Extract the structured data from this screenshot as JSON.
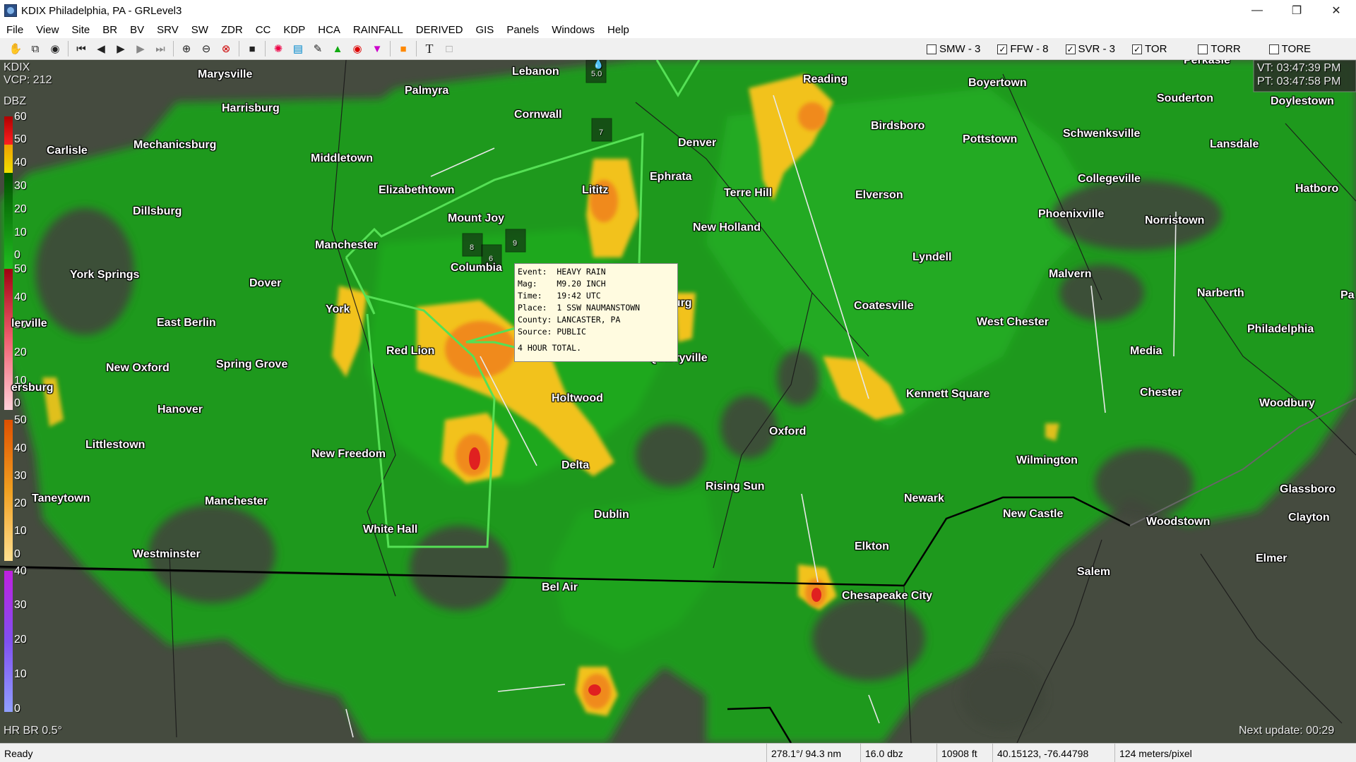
{
  "window": {
    "title": "KDIX Philadelphia, PA - GRLevel3",
    "minimize": "—",
    "maximize": "❐",
    "close": "✕"
  },
  "menu": [
    "File",
    "View",
    "Site",
    "BR",
    "BV",
    "SRV",
    "SW",
    "ZDR",
    "CC",
    "KDP",
    "HCA",
    "RAINFALL",
    "DERIVED",
    "GIS",
    "Panels",
    "Windows",
    "Help"
  ],
  "toolbar": {
    "icons": [
      "hand-icon",
      "copy-icon",
      "radar-sites-icon",
      "first-frame-icon",
      "prev-frame-icon",
      "play-icon",
      "next-frame-icon",
      "last-frame-icon",
      "zoom-in-icon",
      "zoom-out-icon",
      "zoom-reset-icon",
      "stop-icon",
      "storm-icon",
      "color-table-icon",
      "measure-icon",
      "triangle-icon",
      "circle-icon",
      "inverted-triangle-icon",
      "fill-icon",
      "text-icon",
      "square-icon"
    ],
    "warnings": [
      {
        "label": "SMW - 3",
        "checked": false
      },
      {
        "label": "FFW - 8",
        "checked": true
      },
      {
        "label": "SVR - 3",
        "checked": true
      },
      {
        "label": "TOR",
        "checked": true
      },
      {
        "label": "TORR",
        "checked": false
      },
      {
        "label": "TORE",
        "checked": false
      }
    ]
  },
  "map": {
    "site": "KDIX",
    "vcp": "VCP: 212",
    "vt": "VT: 03:47:39 PM",
    "pt": "PT: 03:47:58 PM",
    "product": "HR BR 0.5°",
    "next_update": "Next update: 00:29",
    "legend": {
      "title": "DBZ",
      "scale1": [
        "60",
        "50",
        "40",
        "30",
        "20",
        "10",
        "0"
      ],
      "scale2": [
        "50",
        "40",
        "30",
        "20",
        "10",
        "0"
      ],
      "scale3": [
        "50",
        "40",
        "30",
        "20",
        "10",
        "0"
      ],
      "scale4": [
        "40",
        "30",
        "20",
        "10",
        "0"
      ]
    },
    "towns": [
      "Marysville",
      "Lebanon",
      "Palmyra",
      "Harrisburg",
      "Cornwall",
      "Carlisle",
      "Mechanicsburg",
      "Middletown",
      "Elizabethtown",
      "Lititz",
      "Ephrata",
      "Denver",
      "Terre Hill",
      "Reading",
      "Boyertown",
      "Birdsboro",
      "Pottstown",
      "Schwenksville",
      "Lansdale",
      "Doylestown",
      "Souderton",
      "Perkasie",
      "Dillsburg",
      "Mount Joy",
      "Manchester",
      "Columbia",
      "York Springs",
      "Dover",
      "York",
      "East Berlin",
      "Red Lion",
      "New Holland",
      "Strasburg",
      "Quarryville",
      "Holtwood",
      "Elverson",
      "Lyndell",
      "Coatesville",
      "Collegeville",
      "Phoenixville",
      "Norristown",
      "Hatboro",
      "Malvern",
      "Narberth",
      "West Chester",
      "Philadelphia",
      "Media",
      "Chester",
      "Kennett Square",
      "Woodbury",
      "Oxford",
      "New Oxford",
      "Spring Grove",
      "Hanover",
      "Littlestown",
      "Taneytown",
      "Manchester",
      "New Freedom",
      "Delta",
      "Rising Sun",
      "Newark",
      "Wilmington",
      "Glassboro",
      "New Castle",
      "Clayton",
      "Woodstown",
      "White Hall",
      "Dublin",
      "Westminster",
      "Bel Air",
      "Elkton",
      "Salem",
      "Elmer",
      "Chesapeake City",
      "lerville",
      "ersburg",
      "Pa"
    ],
    "report_markers": [
      "5.0",
      "7",
      "8",
      "6",
      "9"
    ],
    "tooltip": {
      "event": "Event:  HEAVY RAIN",
      "mag": "Mag:    M9.20 INCH",
      "time": "Time:   19:42 UTC",
      "place": "Place:  1 SSW NAUMANSTOWN",
      "county": "County: LANCASTER, PA",
      "source": "Source: PUBLIC",
      "remark": "4 HOUR TOTAL."
    }
  },
  "status": {
    "ready": "Ready",
    "azimuth": "278.1°/ 94.3 nm",
    "value": "16.0 dbz",
    "height": "10908 ft",
    "latlon": "40.15123, -76.44798",
    "scale": "124 meters/pixel"
  }
}
